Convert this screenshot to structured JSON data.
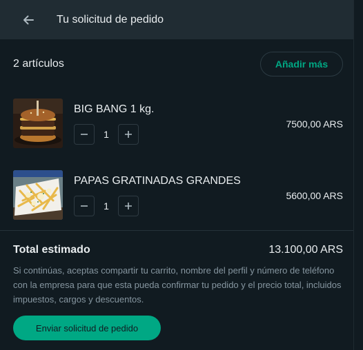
{
  "header": {
    "title": "Tu solicitud de pedido",
    "back_icon": "arrow-left-icon"
  },
  "cart": {
    "count_label": "2 artículos",
    "add_more_label": "Añadir más"
  },
  "items": [
    {
      "name": "BIG BANG 1 kg.",
      "quantity": "1",
      "price": "7500,00 ARS",
      "image": "burger-photo"
    },
    {
      "name": "PAPAS GRATINADAS GRANDES",
      "quantity": "1",
      "price": "5600,00 ARS",
      "image": "fries-photo"
    }
  ],
  "summary": {
    "total_label": "Total estimado",
    "total_value": "13.100,00 ARS",
    "disclaimer": "Si continúas, aceptas compartir tu carrito, nombre del perfil y número de teléfono con la empresa para que esta pueda confirmar tu pedido y el precio total, incluidos impuestos, cargos y descuentos.",
    "send_label": "Enviar solicitud de pedido"
  },
  "colors": {
    "accent": "#00a884",
    "background": "#111b21",
    "header": "#202c33"
  }
}
